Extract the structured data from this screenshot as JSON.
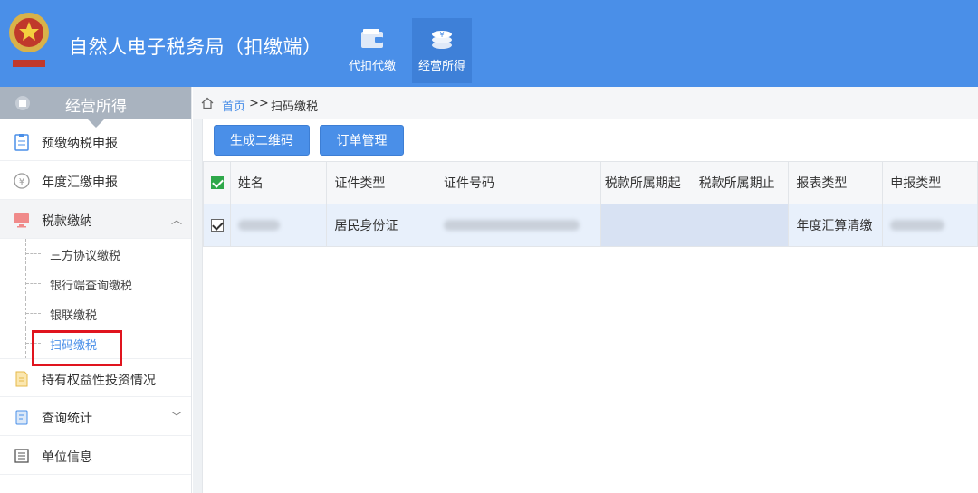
{
  "header": {
    "title": "自然人电子税务局（扣缴端）",
    "tabs": [
      {
        "label": "代扣代缴",
        "icon": "wallet-icon",
        "active": false
      },
      {
        "label": "经营所得",
        "icon": "coins-icon",
        "active": true
      }
    ]
  },
  "sidebar": {
    "title": "经营所得",
    "items": [
      {
        "label": "预缴纳税申报",
        "icon": "clipboard-icon"
      },
      {
        "label": "年度汇缴申报",
        "icon": "yen-icon"
      },
      {
        "label": "税款缴纳",
        "icon": "monitor-icon",
        "expanded": true,
        "children": [
          {
            "label": "三方协议缴税"
          },
          {
            "label": "银行端查询缴税"
          },
          {
            "label": "银联缴税"
          },
          {
            "label": "扫码缴税",
            "current": true
          }
        ]
      },
      {
        "label": "持有权益性投资情况",
        "icon": "document-icon"
      },
      {
        "label": "查询统计",
        "icon": "report-icon",
        "collapsed": true
      },
      {
        "label": "单位信息",
        "icon": "list-icon"
      }
    ]
  },
  "breadcrumb": {
    "home": "首页",
    "sep": ">>",
    "current": "扫码缴税"
  },
  "toolbar": {
    "generate_qr": "生成二维码",
    "order_manage": "订单管理"
  },
  "table": {
    "columns": [
      "姓名",
      "证件类型",
      "证件号码",
      "税款所属期起",
      "税款所属期止",
      "报表类型",
      "申报类型"
    ],
    "rows": [
      {
        "checked": true,
        "id_type": "居民身份证",
        "report_type": "年度汇算清缴"
      }
    ]
  },
  "colors": {
    "header": "#4a8fe8",
    "accent": "#4a8fe8",
    "highlight": "#e0141e"
  }
}
